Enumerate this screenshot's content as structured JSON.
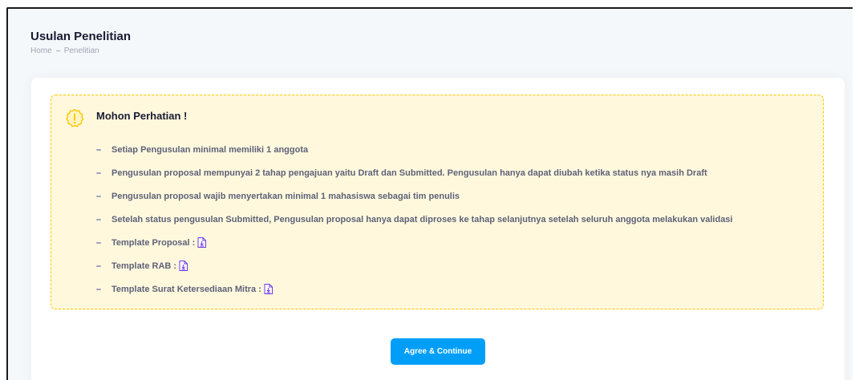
{
  "header": {
    "title": "Usulan Penelitian",
    "breadcrumb": [
      "Home",
      "Penelitian"
    ]
  },
  "notice": {
    "title": "Mohon Perhatian !",
    "items": [
      "Setiap Pengusulan minimal memiliki 1 anggota",
      "Pengusulan proposal mempunyai 2 tahap pengajuan yaitu Draft dan Submitted. Pengusulan hanya dapat diubah ketika status nya masih Draft",
      "Pengusulan proposal wajib menyertakan minimal 1 mahasiswa sebagai tim penulis",
      "Setelah status pengusulan Submitted, Pengusulan proposal hanya dapat diproses ke tahap selanjutnya setelah seluruh anggota melakukan validasi",
      "Template Proposal :",
      "Template RAB :",
      "Template Surat Ketersediaan Mitra :"
    ],
    "icon": "warning-icon",
    "file_icon": "file-download-icon"
  },
  "actions": {
    "agree_label": "Agree & Continue"
  },
  "colors": {
    "primary": "#009ef7",
    "warning": "#ffc700",
    "warning_bg": "#fff8dd",
    "file_icon": "#7239ea"
  }
}
